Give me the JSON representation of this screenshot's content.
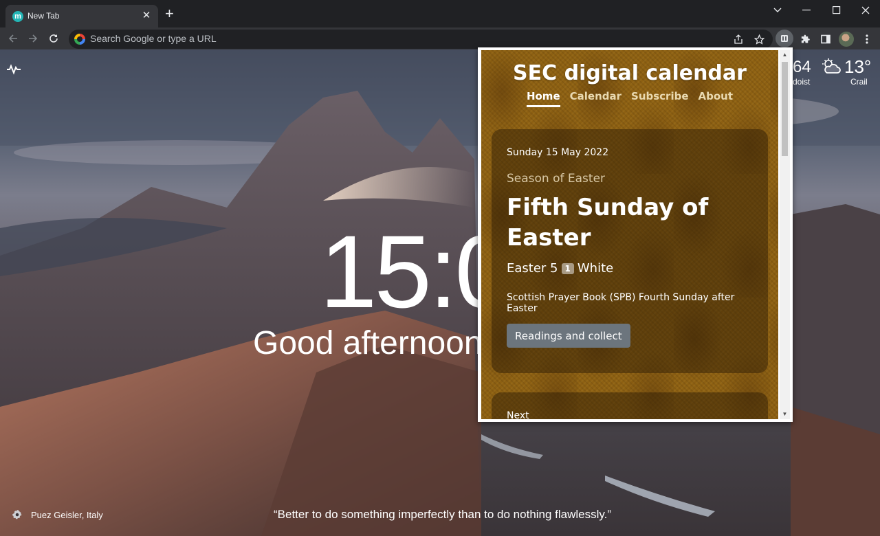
{
  "browser": {
    "tab_title": "New Tab",
    "tab_favicon_letter": "m",
    "omnibox_placeholder": "Search Google or type a URL"
  },
  "ntp": {
    "clock": "15:0",
    "greeting": "Good afternoon",
    "widget_number": "64",
    "widget_sublabel": "doist",
    "temperature": "13°",
    "city": "Crail",
    "location": "Puez Geisler, Italy",
    "quote": "“Better to do something imperfectly than to do nothing flawlessly.”"
  },
  "popup": {
    "title": "SEC digital calendar",
    "nav": [
      "Home",
      "Calendar",
      "Subscribe",
      "About"
    ],
    "date": "Sunday 15 May 2022",
    "season": "Season of Easter",
    "day_title": "Fifth Sunday of Easter",
    "week_label": "Easter 5",
    "week_number": "1",
    "liturgical_colour": "White",
    "spb_note": "Scottish Prayer Book (SPB) Fourth Sunday after Easter",
    "readings_button": "Readings and collect",
    "next_label": "Next"
  },
  "colors": {
    "chrome_dark": "#202124",
    "toolbar": "#35363a",
    "popup_gold": "#8d6012",
    "button_grey": "#6c757d"
  }
}
